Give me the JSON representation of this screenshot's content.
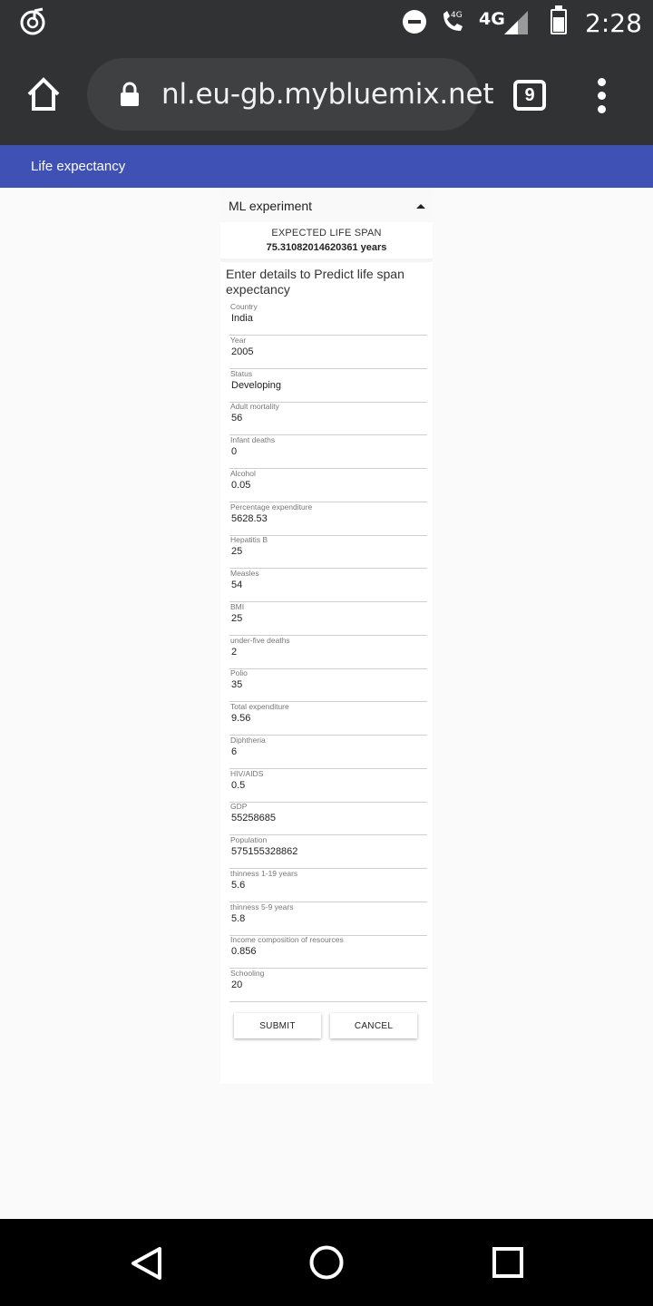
{
  "status_bar": {
    "network_type_badge": "4G",
    "network_type": "4G",
    "time": "2:28",
    "icons": [
      "music-app-icon",
      "do-not-disturb-icon",
      "volte-call-icon",
      "signal-icon",
      "battery-icon"
    ]
  },
  "browser": {
    "url": "nl.eu-gb.mybluemix.net",
    "tab_count": "9",
    "icons": [
      "home-icon",
      "lock-icon",
      "tabs-icon",
      "more-menu-icon"
    ]
  },
  "app": {
    "title": "Life expectancy",
    "accent_color": "#3f51b5"
  },
  "panel": {
    "title": "ML experiment",
    "result_label": "EXPECTED LIFE SPAN",
    "result_value": "75.31082014620361 years",
    "intro": "Enter details to Predict life span expectancy"
  },
  "fields": [
    {
      "label": "Country",
      "value": "India"
    },
    {
      "label": "Year",
      "value": "2005"
    },
    {
      "label": "Status",
      "value": "Developing"
    },
    {
      "label": "Adult mortality",
      "value": "56"
    },
    {
      "label": "Infant deaths",
      "value": "0"
    },
    {
      "label": "Alcohol",
      "value": "0.05"
    },
    {
      "label": "Percentage expenditure",
      "value": "5628.53"
    },
    {
      "label": "Hepatitis B",
      "value": "25"
    },
    {
      "label": "Measles",
      "value": "54"
    },
    {
      "label": "BMI",
      "value": "25"
    },
    {
      "label": "under-five deaths",
      "value": "2"
    },
    {
      "label": "Polio",
      "value": "35"
    },
    {
      "label": "Total expenditure",
      "value": "9.56"
    },
    {
      "label": "Diphtheria",
      "value": "6"
    },
    {
      "label": "HIV/AIDS",
      "value": "0.5"
    },
    {
      "label": "GDP",
      "value": "55258685"
    },
    {
      "label": "Population",
      "value": "575155328862"
    },
    {
      "label": "thinness 1-19 years",
      "value": "5.6"
    },
    {
      "label": "thinness 5-9 years",
      "value": "5.8"
    },
    {
      "label": "Income composition of resources",
      "value": "0.856"
    },
    {
      "label": "Schooling",
      "value": "20"
    }
  ],
  "buttons": {
    "submit": "SUBMIT",
    "cancel": "CANCEL"
  },
  "nav_bar": {
    "icons": [
      "back-icon",
      "home-circle-icon",
      "recents-icon"
    ]
  }
}
